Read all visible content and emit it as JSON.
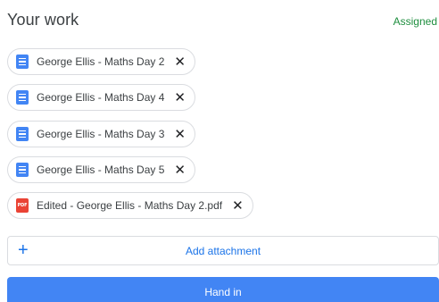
{
  "header": {
    "title": "Your work",
    "status": "Assigned"
  },
  "attachments": [
    {
      "name": "George Ellis - Maths Day 2",
      "type": "doc",
      "icon": "google-docs-icon"
    },
    {
      "name": "George Ellis - Maths Day 4",
      "type": "doc",
      "icon": "google-docs-icon"
    },
    {
      "name": "George Ellis - Maths Day 3",
      "type": "doc",
      "icon": "google-docs-icon"
    },
    {
      "name": "George Ellis - Maths Day 5",
      "type": "doc",
      "icon": "google-docs-icon"
    },
    {
      "name": "Edited - George Ellis - Maths Day 2.pdf",
      "type": "pdf",
      "icon": "pdf-icon",
      "icon_text": "PDF"
    }
  ],
  "remove_glyph": "✕",
  "add_attachment": {
    "plus": "+",
    "label": "Add attachment"
  },
  "hand_in": {
    "label": "Hand in"
  },
  "colors": {
    "accent": "#1a73e8",
    "button": "#4285f4",
    "status": "#1e8e3e",
    "doc_icon": "#4285f4",
    "pdf_icon": "#ea4335"
  }
}
